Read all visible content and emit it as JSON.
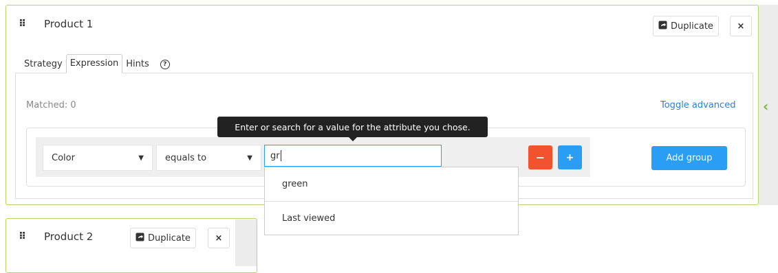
{
  "product1": {
    "title": "Product 1",
    "duplicate_label": "Duplicate",
    "close_label": "×",
    "tabs": [
      {
        "label": "Strategy",
        "active": false
      },
      {
        "label": "Expression",
        "active": true
      },
      {
        "label": "Hints",
        "active": false
      }
    ],
    "help_label": "?",
    "matched_text": "Matched: 0",
    "toggle_advanced_label": "Toggle advanced",
    "condition": {
      "attribute_value": "Color",
      "operator_value": "equals to",
      "value_input": "gr"
    },
    "minus_label": "−",
    "plus_label": "+",
    "add_group_label": "Add group",
    "tooltip": "Enter or search for a value for the attribute you chose.",
    "suggestions": [
      "green",
      "Last viewed"
    ]
  },
  "product2": {
    "title": "Product 2",
    "duplicate_label": "Duplicate",
    "close_label": "×"
  },
  "colors": {
    "accent_green": "#b5d56a",
    "primary_blue": "#2a9df4",
    "danger_red": "#f0532e"
  }
}
